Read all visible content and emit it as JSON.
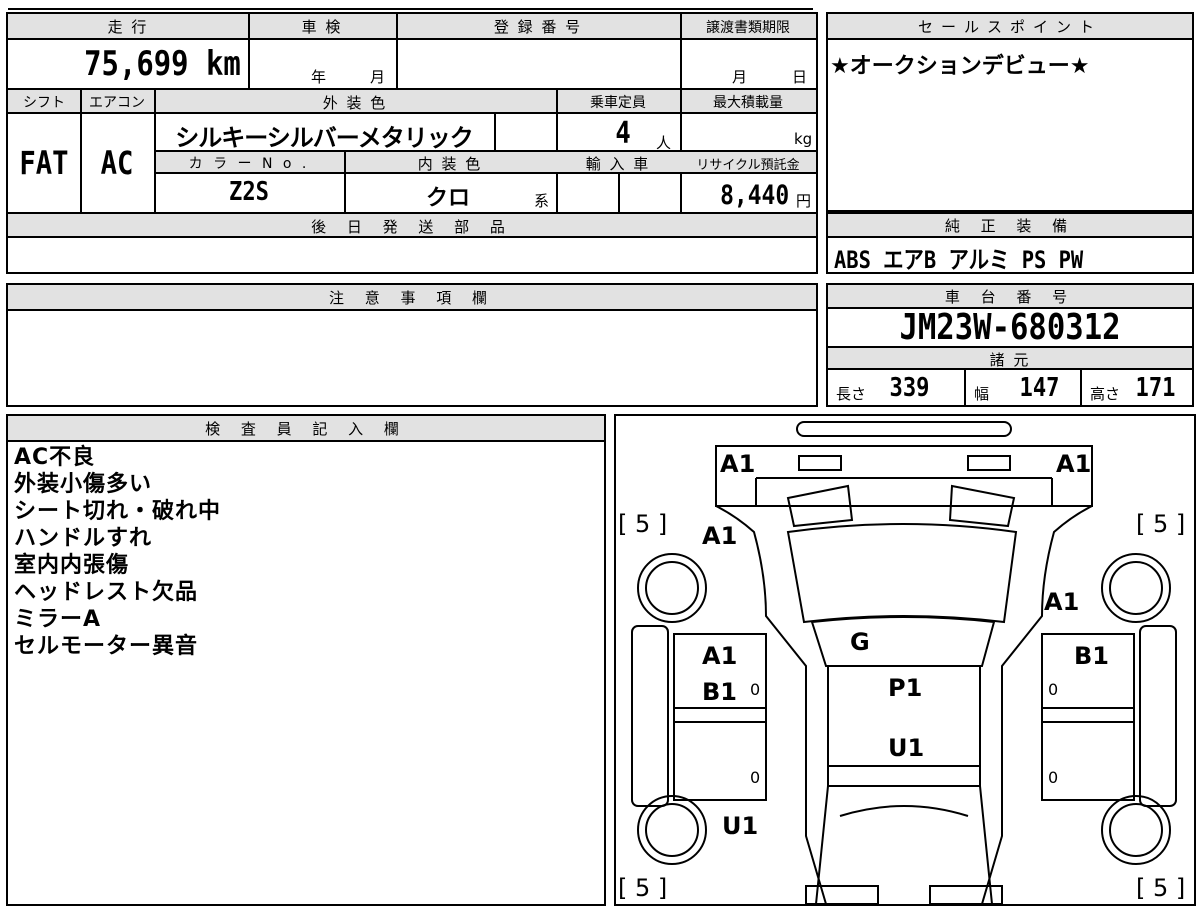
{
  "vehicle": {
    "mileage_label": "走 行",
    "mileage": "75,699 km",
    "inspection_label": "車 検",
    "inspection_year": "年",
    "inspection_month": "月",
    "registration_label": "登 録 番 号",
    "transfer_label": "譲渡書類期限",
    "transfer_month": "月",
    "transfer_day": "日",
    "shift_label": "シフト",
    "shift": "FAT",
    "ac_label": "エアコン",
    "ac": "AC",
    "exterior_label": "外 装 色",
    "exterior": "シルキーシルバーメタリック",
    "capacity_label": "乗車定員",
    "capacity": "4",
    "capacity_unit": "人",
    "maxload_label": "最大積載量",
    "maxload_unit": "kg",
    "color_no_label": "カ ラ ー N o .",
    "color_no": "Z2S",
    "interior_label": "内 装 色",
    "interior": "クロ",
    "interior_suffix": "系",
    "import_label": "輸 入 車",
    "recycle_label": "リサイクル預託金",
    "recycle": "8,440",
    "recycle_unit": "円",
    "later_parts_label": "後 日 発 送 部 品",
    "notes_label": "注 意 事 項 欄"
  },
  "sales": {
    "label": "セールスポイント",
    "text": "★オークションデビュー★"
  },
  "equipment": {
    "label": "純 正 装 備",
    "items": "ABS エアB アルミ PS PW"
  },
  "chassis": {
    "label": "車 台 番 号",
    "number": "JM23W-680312"
  },
  "specs": {
    "label": "諸 元",
    "length_label": "長さ",
    "length": "339",
    "width_label": "幅",
    "width": "147",
    "height_label": "高さ",
    "height": "171"
  },
  "inspector": {
    "label": "検 査 員 記 入 欄",
    "notes": [
      "AC不良",
      "外装小傷多い",
      "シート切れ・破れ中",
      "ハンドルすれ",
      "室内内張傷",
      "ヘッドレスト欠品",
      "ミラーA",
      "セルモーター異音"
    ]
  },
  "diagram": {
    "front_left": "A1",
    "front_right": "A1",
    "fender_left": "A1",
    "fender_right": "A1",
    "hood": "G",
    "door_left_top": "A1",
    "door_left_bottom": "B1",
    "door_right_top": "B1",
    "roof_front": "P1",
    "roof_rear": "U1",
    "rear_left": "U1",
    "tire_fl": "[ 5 ]",
    "tire_fr": "[ 5 ]",
    "tire_rl": "[ 5 ]",
    "tire_rr": "[ 5 ]",
    "door_zero_1": "0",
    "door_zero_2": "0",
    "door_zero_3": "0",
    "door_zero_4": "0"
  }
}
